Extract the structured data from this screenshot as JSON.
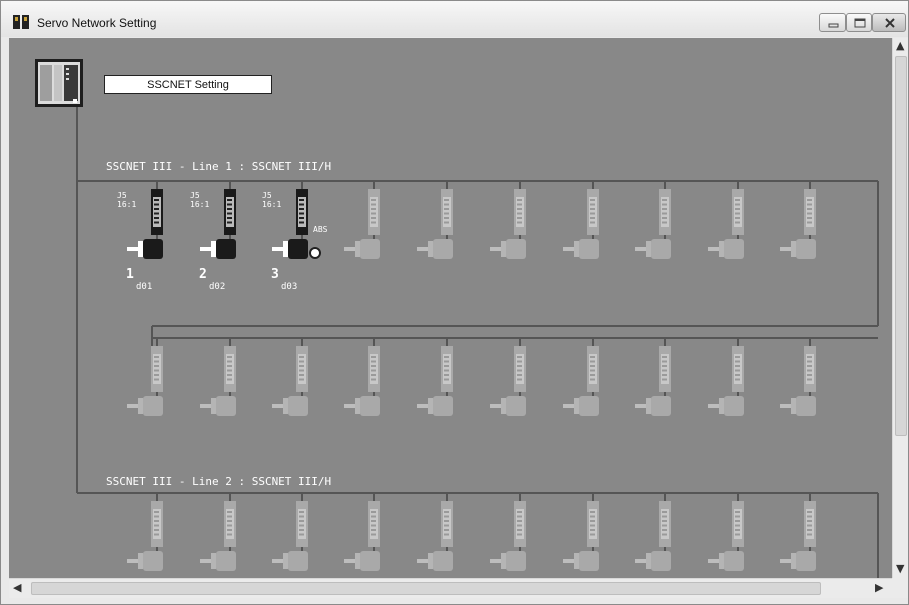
{
  "window": {
    "title": "Servo Network Setting"
  },
  "diagram": {
    "setting_button": "SSCNET Setting",
    "lines": [
      {
        "label": "SSCNET III - Line 1 : SSCNET III/H"
      },
      {
        "label": "SSCNET III - Line 2 : SSCNET III/H"
      }
    ],
    "configured_axes": [
      {
        "model": "J5",
        "ratio": "16:1",
        "number": "1",
        "name": "d01",
        "abs": ""
      },
      {
        "model": "J5",
        "ratio": "16:1",
        "number": "2",
        "name": "d02",
        "abs": ""
      },
      {
        "model": "J5",
        "ratio": "16:1",
        "number": "3",
        "name": "d03",
        "abs": "ABS"
      }
    ]
  },
  "colors": {
    "background": "#888888",
    "wire": "#555555",
    "placeholder": "#a9a9a9",
    "configured": "#1a1a1a"
  },
  "icons": {
    "app": "servo-network-icon",
    "controller": "motion-controller-icon",
    "amplifier": "servo-amplifier-icon",
    "motor": "servo-motor-icon"
  }
}
